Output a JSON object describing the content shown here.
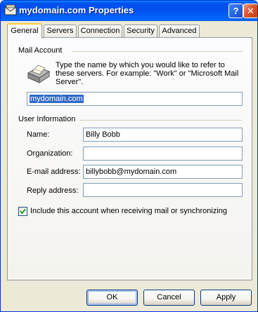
{
  "window": {
    "title": "mydomain.com Properties",
    "help_label": "?",
    "close_label": "✕"
  },
  "tabs": [
    {
      "label": "General",
      "active": true
    },
    {
      "label": "Servers",
      "active": false
    },
    {
      "label": "Connection",
      "active": false
    },
    {
      "label": "Security",
      "active": false
    },
    {
      "label": "Advanced",
      "active": false
    }
  ],
  "mail_account": {
    "group_label": "Mail Account",
    "description": "Type the name by which you would like to refer to these servers.  For example: \"Work\" or \"Microsoft Mail Server\".",
    "account_name": "mydomain.com"
  },
  "user_info": {
    "group_label": "User Information",
    "name_label": "Name:",
    "name_value": "Billy Bobb",
    "organization_label": "Organization:",
    "organization_value": "",
    "email_label": "E-mail address:",
    "email_value": "billybobb@mydomain.com",
    "reply_label": "Reply address:",
    "reply_value": ""
  },
  "include_account": {
    "checked": true,
    "label": "Include this account when receiving mail or synchronizing"
  },
  "buttons": {
    "ok": "OK",
    "cancel": "Cancel",
    "apply": "Apply"
  },
  "colors": {
    "titlebar": "#0053ee",
    "dialog_bg": "#ece9d8",
    "selection": "#316ac5",
    "active_tab_accent": "#ffc83c"
  }
}
